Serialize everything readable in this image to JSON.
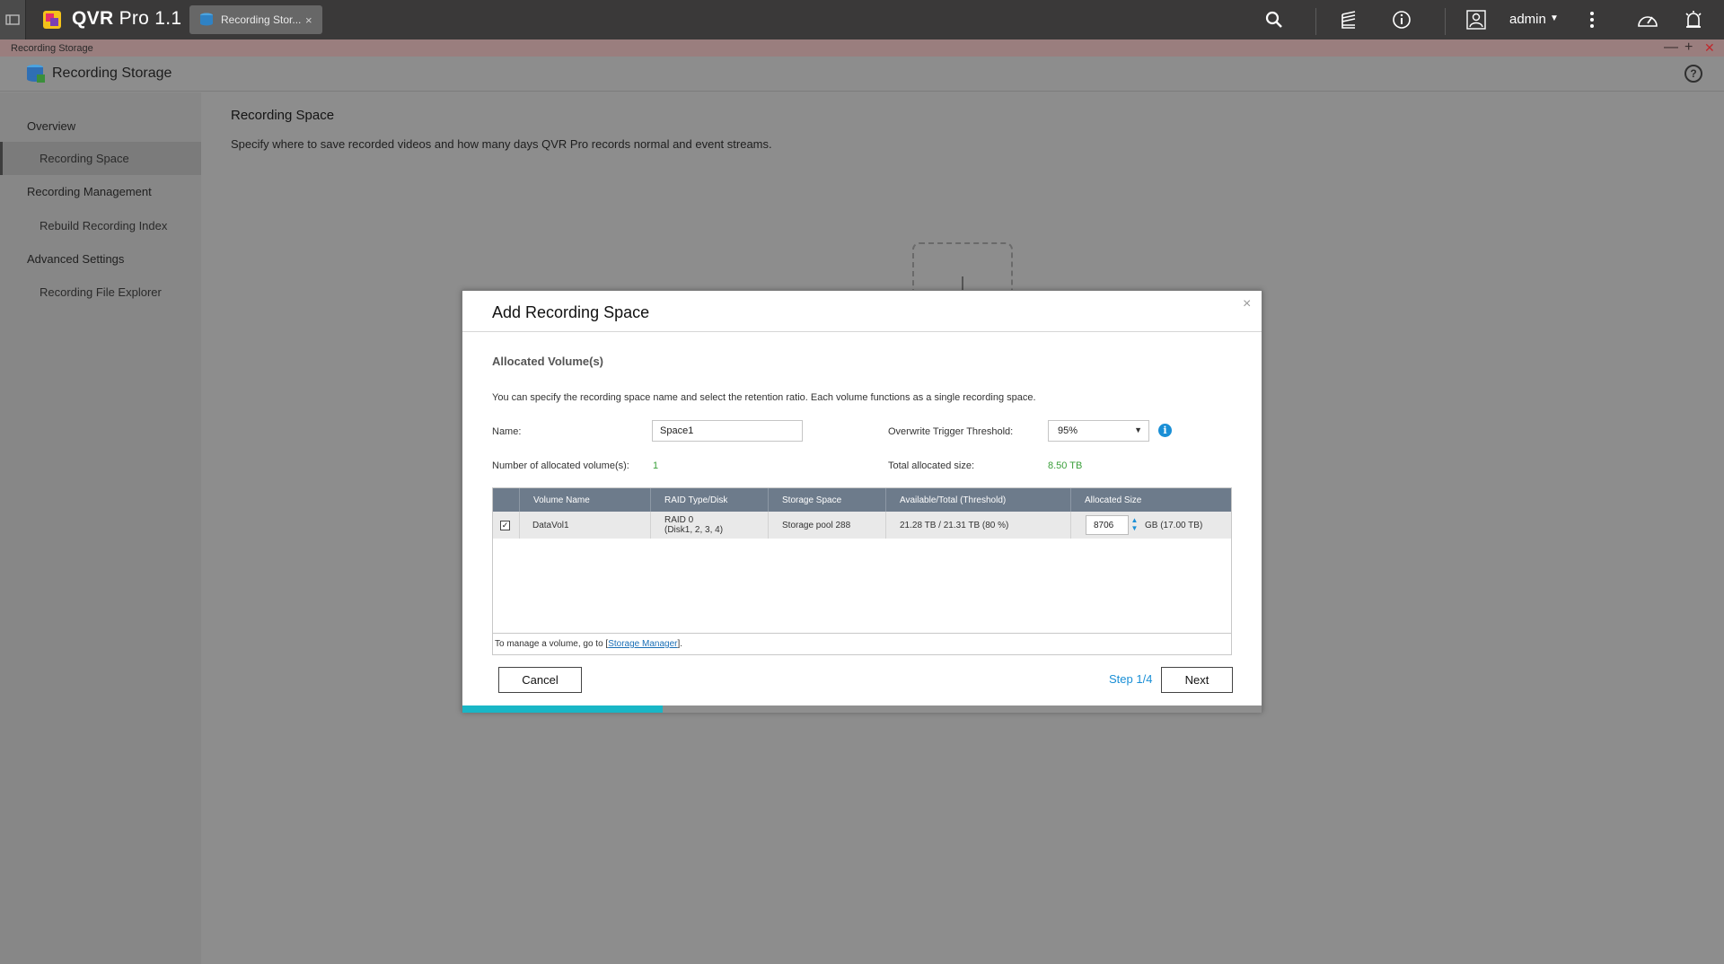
{
  "topbar": {
    "app_name": "QVR",
    "app_suffix": "Pro 1.1",
    "tab_label": "Recording Stor...",
    "tab_close": "×",
    "user": "admin",
    "user_caret": "▼"
  },
  "window": {
    "title": "Recording Storage",
    "minimize": "—",
    "maximize": "+",
    "close": "✕"
  },
  "app_header": {
    "title": "Recording Storage",
    "help": "?"
  },
  "sidebar": {
    "items": [
      {
        "label": "Overview"
      },
      {
        "label": "Recording Space"
      },
      {
        "label": "Recording Management"
      },
      {
        "label": "Rebuild Recording Index"
      },
      {
        "label": "Advanced Settings"
      },
      {
        "label": "Recording File Explorer"
      }
    ]
  },
  "main": {
    "title": "Recording Space",
    "description": "Specify where to save recorded videos and how many days QVR Pro records normal and event streams."
  },
  "modal": {
    "title": "Add Recording Space",
    "close": "×",
    "section": "Allocated Volume(s)",
    "intro": "You can specify the recording space name and select the retention ratio. Each volume functions as a single recording space.",
    "name_label": "Name:",
    "name_value": "Space1",
    "threshold_label": "Overwrite Trigger Threshold:",
    "threshold_value": "95%",
    "info": "i",
    "num_volumes_label": "Number of allocated volume(s):",
    "num_volumes_value": "1",
    "total_size_label": "Total allocated size:",
    "total_size_value": "8.50 TB",
    "table": {
      "headers": [
        "Volume Name",
        "RAID Type/Disk",
        "Storage Space",
        "Available/Total (Threshold)",
        "Allocated Size"
      ],
      "rows": [
        {
          "checked": "✓",
          "volume": "DataVol1",
          "raid_line1": "RAID 0",
          "raid_line2": "(Disk1, 2, 3, 4)",
          "storage": "Storage pool 288",
          "available": "21.28 TB / 21.31 TB (80 %)",
          "allocated": "8706",
          "unit": "GB (17.00 TB)"
        }
      ],
      "footer_prefix": "To manage a volume, go to [",
      "footer_link": "Storage Manager",
      "footer_suffix": "]."
    },
    "cancel": "Cancel",
    "step": "Step 1/4",
    "next": "Next",
    "progress_fraction": 0.25
  },
  "colors": {
    "accent": "#1a8fd6",
    "progress": "#19b6c6",
    "green": "#3a9f3a",
    "table_header": "#6d7b8b"
  }
}
